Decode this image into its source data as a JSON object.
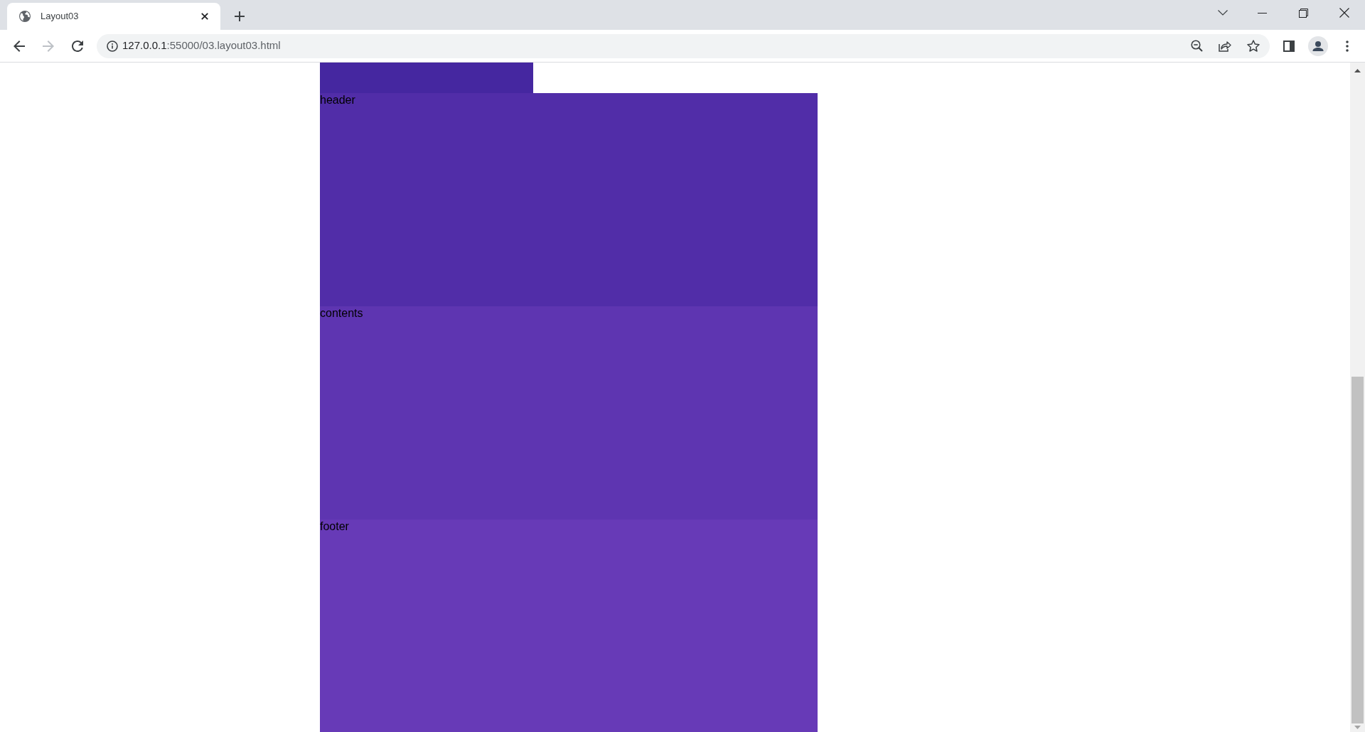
{
  "browser": {
    "tabs": [
      {
        "title": "Layout03",
        "selected": true
      }
    ],
    "nav_buttons": [
      {
        "kind": "back",
        "disabled": false
      },
      {
        "kind": "forward",
        "disabled": true
      },
      {
        "kind": "reload",
        "disabled": false
      }
    ],
    "address_bar": {
      "url_host": "127.0.0.1",
      "url_rest": ":55000/03.layout03.html"
    }
  },
  "page": {
    "blocks": [
      {
        "kind": "bar",
        "color": "#4527a0"
      },
      {
        "kind": "section",
        "label": "header",
        "color": "#512da8"
      },
      {
        "kind": "section",
        "label": "contents",
        "color": "#5e35b1"
      },
      {
        "kind": "section",
        "label": "footer",
        "color": "#673ab7"
      }
    ]
  }
}
